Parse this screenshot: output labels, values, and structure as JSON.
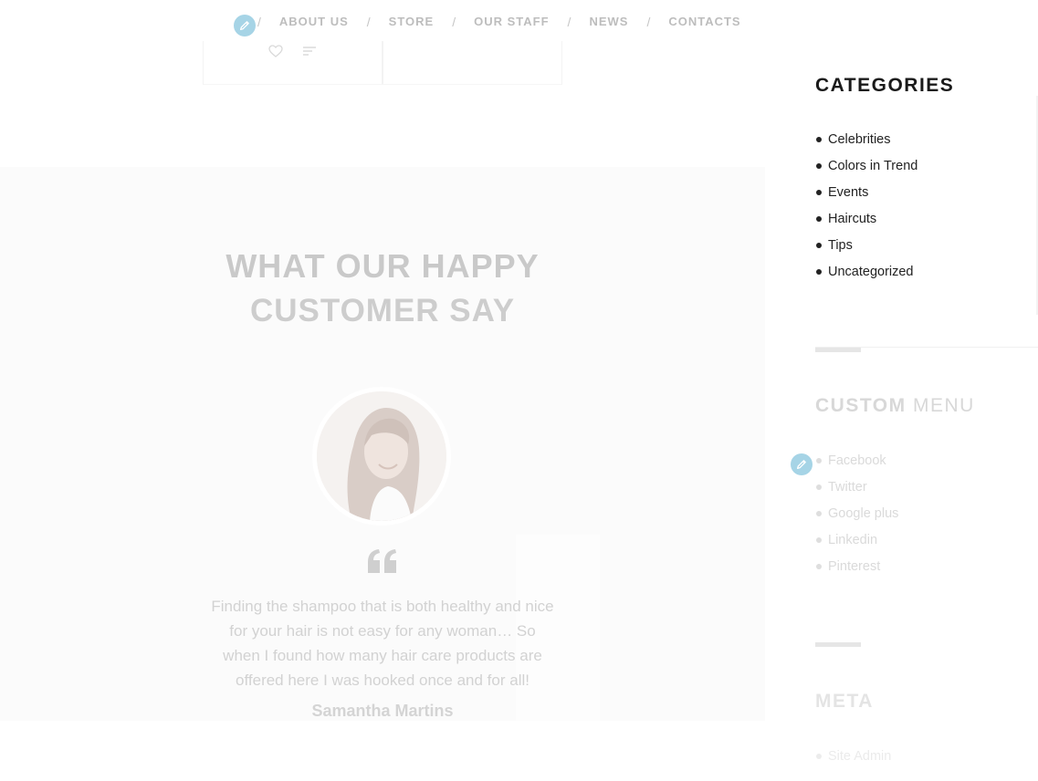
{
  "nav": {
    "separator": "/",
    "items": [
      {
        "label": "ABOUT US"
      },
      {
        "label": "STORE"
      },
      {
        "label": "OUR STAFF"
      },
      {
        "label": "NEWS"
      },
      {
        "label": "CONTACTS"
      }
    ]
  },
  "icons": {
    "edit": "pencil-icon",
    "wishlist": "heart-icon",
    "compare": "filter-lines-icon",
    "quote": "quote-icon"
  },
  "testimonial": {
    "title": "WHAT OUR HAPPY",
    "subtitle": "CUSTOMER SAY",
    "quote": "Finding the shampoo that is both healthy and nice for your hair is not easy for any woman… So when I found how many hair care products are offered here I was hooked once and for all!",
    "author": "Samantha Martins"
  },
  "sidebar": {
    "categories": {
      "title": "CATEGORIES",
      "items": [
        "Celebrities",
        "Colors in Trend",
        "Events",
        "Haircuts",
        "Tips",
        "Uncategorized"
      ]
    },
    "custom_menu": {
      "title_bold": "CUSTOM",
      "title_light": "MENU",
      "items": [
        "Facebook",
        "Twitter",
        "Google plus",
        "Linkedin",
        "Pinterest"
      ]
    },
    "meta": {
      "title": "META",
      "items": [
        "Site Admin"
      ]
    }
  },
  "colors": {
    "accent_edit": "#a6d4e6",
    "heading_dark": "#1a1a1a",
    "faded_text": "#c9c9c9",
    "section_bg": "#fbfbfb"
  }
}
